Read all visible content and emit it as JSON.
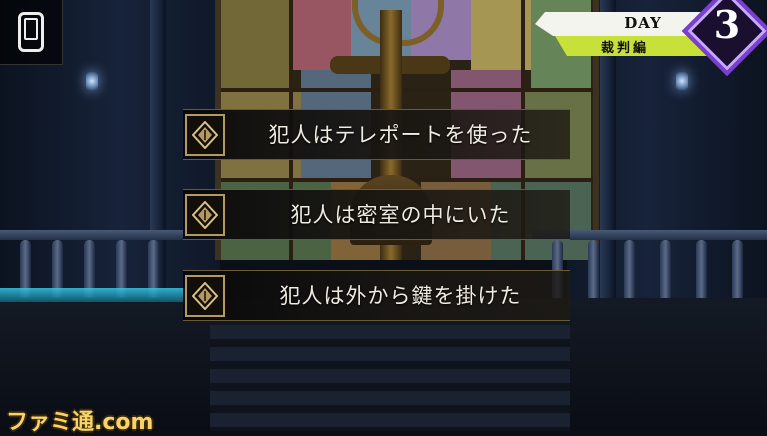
{
  "hud": {
    "phone_button_icon": "smartphone-icon",
    "day_label": "DAY",
    "day_number": "3",
    "chapter_label": "裁判編"
  },
  "choices": [
    {
      "label": "犯人はテレポートを使った",
      "icon": "diamond-emblem-icon"
    },
    {
      "label": "犯人は密室の中にいた",
      "icon": "diamond-emblem-icon"
    },
    {
      "label": "犯人は外から鍵を掛けた",
      "icon": "diamond-emblem-icon"
    }
  ],
  "watermark": "ファミ通.com",
  "colors": {
    "choice_border": "#b49a62",
    "day_accent": "#c8e03a",
    "day_diamond": "#7b3fd0",
    "floor_glow": "#35c8e6"
  }
}
